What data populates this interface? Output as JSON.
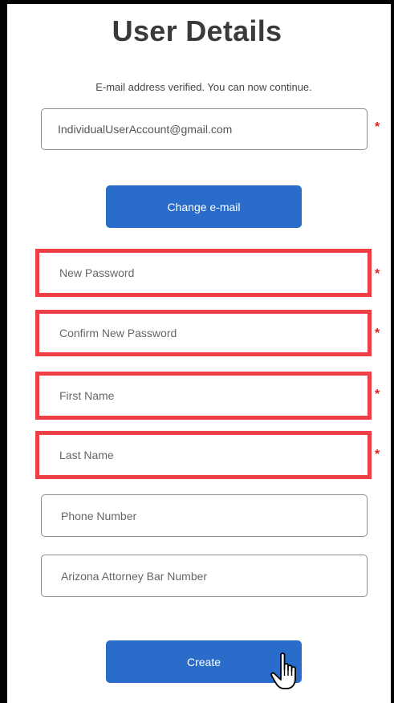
{
  "page": {
    "title": "User Details",
    "notice": "E-mail address verified. You can now continue."
  },
  "email": {
    "value": "IndividualUserAccount@gmail.com",
    "required_mark": "*"
  },
  "buttons": {
    "change_email": "Change e-mail",
    "create": "Create"
  },
  "fields": {
    "new_password": {
      "placeholder": "New Password",
      "required_mark": "*"
    },
    "confirm_password": {
      "placeholder": "Confirm New Password",
      "required_mark": "*"
    },
    "first_name": {
      "placeholder": "First Name",
      "required_mark": "*"
    },
    "last_name": {
      "placeholder": "Last Name",
      "required_mark": "*"
    },
    "phone": {
      "placeholder": "Phone Number"
    },
    "bar_number": {
      "placeholder": "Arizona Attorney Bar Number"
    }
  },
  "colors": {
    "button": "#2a6cc9",
    "highlight": "#ef3f46",
    "required": "#e02020"
  },
  "icons": {
    "cursor": "hand-pointer-icon"
  }
}
